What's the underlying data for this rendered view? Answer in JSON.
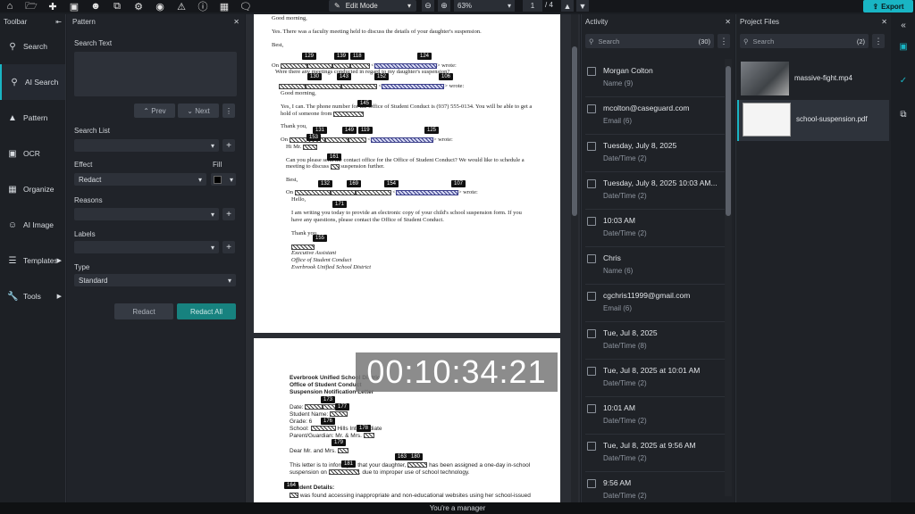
{
  "topbar": {
    "edit_mode": "Edit Mode",
    "zoom": "63%",
    "page_current": "1",
    "page_total": "/ 4",
    "export_label": "Export",
    "accent": "#19b5c4"
  },
  "leftnav": {
    "title": "Toolbar",
    "items": [
      {
        "label": "Search",
        "icon": "search-icon"
      },
      {
        "label": "AI Search",
        "icon": "ai-search-icon"
      },
      {
        "label": "Pattern",
        "icon": "pattern-icon"
      },
      {
        "label": "OCR",
        "icon": "ocr-icon"
      },
      {
        "label": "Organize",
        "icon": "organize-icon"
      },
      {
        "label": "AI Image",
        "icon": "ai-image-icon"
      },
      {
        "label": "Templates",
        "icon": "templates-icon"
      },
      {
        "label": "Tools",
        "icon": "tools-icon"
      }
    ]
  },
  "pattern": {
    "title": "Pattern",
    "search_text_label": "Search Text",
    "prev_label": "Prev",
    "next_label": "Next",
    "search_list_label": "Search List",
    "effect_label": "Effect",
    "effect_value": "Redact",
    "fill_label": "Fill",
    "reasons_label": "Reasons",
    "labels_label": "Labels",
    "type_label": "Type",
    "type_value": "Standard",
    "redact_label": "Redact",
    "redact_all_label": "Redact All"
  },
  "doc": {
    "p1": {
      "l1": "Good morning,",
      "l2": "Yes. There was a faculty meeting held to discuss the details of your daughter's suspension.",
      "l3": "Best,",
      "l4a": "On",
      "l4b": "wrote:",
      "l5": "Were there any meetings conducted in regard to my daughter's suspension?",
      "l6b": "wrote:",
      "l7": "Good morning,",
      "l8": "Yes, I can. The phone number for the Office of Student Conduct is (937) 555-0134. You will be able to get a",
      "l9": "hold of someone from",
      "l10": "Thank you,",
      "l11a": "On",
      "l11b": "wrote:",
      "l12": "Hi Mr.",
      "l13": "Can you please send the contact office for the Office of Student Conduct? We would like to schedule a",
      "l14": "meeting to discuss",
      "l14b": "suspension further.",
      "l15": "Best,",
      "l16a": "On",
      "l16b": "wrote:",
      "l17": "Hello,",
      "l18": "I am writing you today to provide an electronic copy of your child's school suspension form. If you",
      "l19": "have any questions, please contact the Office of Student Conduct.",
      "l20": "Thank you,",
      "l21": "Executive Assistant",
      "l22": "Office of Student Conduct",
      "l23": "Everbrook Unified School District"
    },
    "p2": {
      "h1": "Everbrook Unified School District",
      "h2": "Office of Student Conduct",
      "h3": "Suspension Notification Letter",
      "date": "Date:",
      "student": "Student Name:",
      "grade": "Grade: 6",
      "school": "School:",
      "school_b": "Hills Intermediate",
      "parent": "Parent/Guardian: Mr. & Mrs.",
      "dear": "Dear Mr. and Mrs.",
      "body1": "This letter is to inform you that your daughter,",
      "body1b": "has been assigned a one-day in-school",
      "body2": "suspension on",
      "body2b": ", due to improper use of school technology.",
      "details": "Incident Details:",
      "body3": "was found accessing inappropriate and non-educational websites using her school-issued"
    },
    "tags": [
      "129",
      "139",
      "118",
      "124",
      "130",
      "143",
      "152",
      "106",
      "145",
      "131",
      "149",
      "119",
      "125",
      "153",
      "161",
      "132",
      "169",
      "154",
      "107",
      "171",
      "155",
      "173",
      "177",
      "176",
      "178",
      "179",
      "163",
      "180",
      "181",
      "164"
    ],
    "timer": "00:10:34:21"
  },
  "activity": {
    "title": "Activity",
    "search_placeholder": "Search",
    "count": "(30)",
    "items": [
      {
        "title": "Morgan Colton",
        "sub": "Name  (9)"
      },
      {
        "title": "mcolton@caseguard.com",
        "sub": "Email  (6)"
      },
      {
        "title": "Tuesday, July 8, 2025",
        "sub": "Date/Time  (2)"
      },
      {
        "title": "Tuesday, July 8, 2025 10:03 AM...",
        "sub": "Date/Time  (2)"
      },
      {
        "title": "10:03 AM",
        "sub": "Date/Time  (2)"
      },
      {
        "title": "Chris",
        "sub": "Name  (6)"
      },
      {
        "title": "cgchris11999@gmail.com",
        "sub": "Email  (6)"
      },
      {
        "title": "Tue, Jul 8, 2025",
        "sub": "Date/Time  (8)"
      },
      {
        "title": "Tue, Jul 8, 2025 at 10:01 AM",
        "sub": "Date/Time  (2)"
      },
      {
        "title": "10:01 AM",
        "sub": "Date/Time  (2)"
      },
      {
        "title": "Tue, Jul 8, 2025 at 9:56 AM",
        "sub": "Date/Time  (2)"
      },
      {
        "title": "9:56 AM",
        "sub": "Date/Time  (2)"
      }
    ]
  },
  "project": {
    "title": "Project Files",
    "search_placeholder": "Search",
    "count": "(2)",
    "files": [
      {
        "name": "massive-fight.mp4"
      },
      {
        "name": "school-suspension.pdf"
      }
    ]
  },
  "footer": {
    "text": "You're a manager"
  }
}
